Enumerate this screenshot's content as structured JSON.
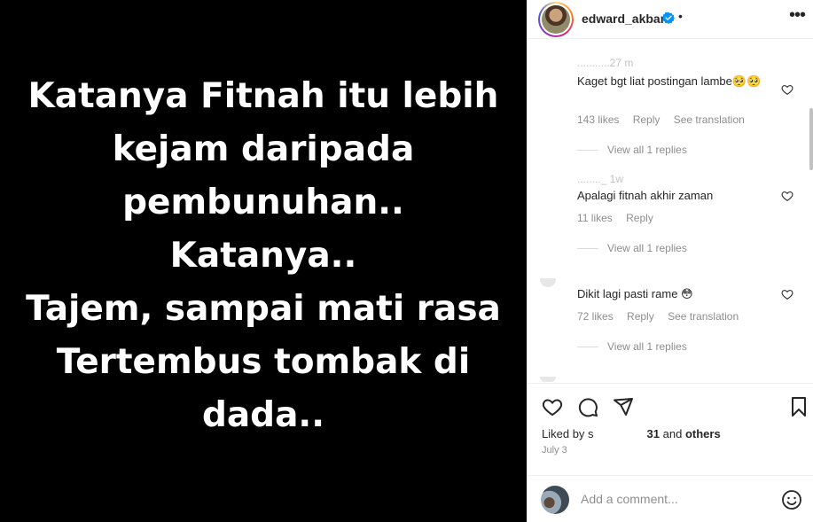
{
  "post": {
    "lines": [
      "Katanya Fitnah itu lebih",
      "kejam daripada",
      "pembunuhan..",
      "Katanya..",
      "Tajem, sampai mati rasa",
      "Tertembus tombak di",
      "dada.."
    ]
  },
  "header": {
    "username": "edward_akbar",
    "separator": "•",
    "more": "•••"
  },
  "comments": [
    {
      "ghost_user": "...........27 m",
      "text": "Kaget bgt liat postingan lambe🥺🥺",
      "likes": "143 likes",
      "reply": "Reply",
      "translate": "See translation",
      "view_replies": "View all 1 replies"
    },
    {
      "ghost_user": "........_ 1w",
      "text": "Apalagi fitnah akhir zaman",
      "likes": "11 likes",
      "reply": "Reply",
      "translate": "",
      "view_replies": "View all 1 replies"
    },
    {
      "ghost_user": "",
      "text": "Dikit lagi pasti rame 😳",
      "likes": "72 likes",
      "reply": "Reply",
      "translate": "See translation",
      "view_replies": "View all 1 replies"
    }
  ],
  "footer": {
    "liked_prefix": "Liked by s",
    "liked_user_tail": "31",
    "liked_and": " and ",
    "liked_others": "others",
    "date": "July 3",
    "comment_placeholder": "Add a comment..."
  },
  "icons": {
    "like": "heart-icon",
    "comment": "comment-icon",
    "share": "share-icon",
    "save": "bookmark-icon",
    "emoji": "emoji-icon",
    "verified": "verified-badge-icon"
  },
  "colors": {
    "verified": "#0095f6",
    "text": "#262626",
    "muted": "#8e8e8e"
  }
}
